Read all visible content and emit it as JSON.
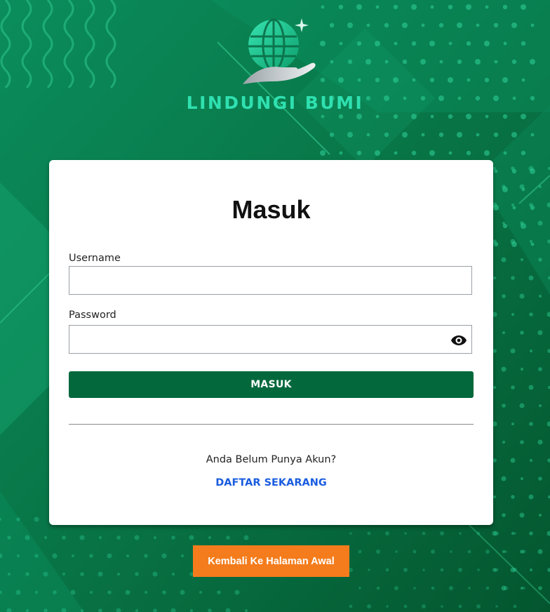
{
  "brand": {
    "logo_name": "globe-hand-icon",
    "name": "LINDUNGI BUMI"
  },
  "login_form": {
    "title": "Masuk",
    "username_label": "Username",
    "username_value": "",
    "password_label": "Password",
    "password_value": "",
    "password_toggle_icon": "eye-icon",
    "submit_label": "MASUK"
  },
  "register": {
    "prompt": "Anda Belum Punya Akun?",
    "link_label": "DAFTAR SEKARANG"
  },
  "back_button_label": "Kembali Ke Halaman Awal",
  "colors": {
    "background": "#0a7a4e",
    "brand_text": "#2fe0b0",
    "primary_button": "#03693d",
    "register_link": "#1a5ce0",
    "back_button": "#f47c1c"
  }
}
